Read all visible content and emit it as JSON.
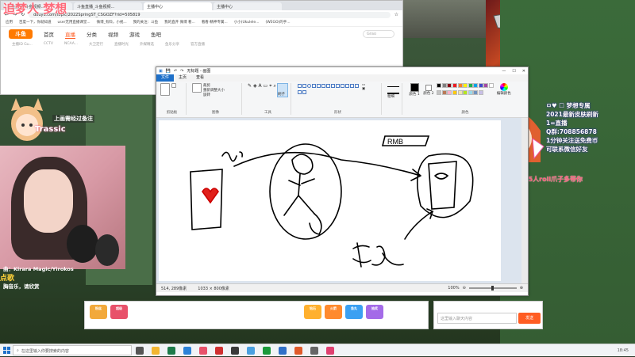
{
  "stream": {
    "title": "追梦人 梦想",
    "chat_notice": "上画需经过备注",
    "chat_user": "Trassic",
    "music_label": "曲：Kirara Magic/Yirokos",
    "music_song": "胸音乐，请欣赏",
    "order_tag": "点歌",
    "rank_text": "钻排近2小时5人roll爪子多带你",
    "right_lines": [
      "ㅁ♥ ☐ 梦想专属",
      "2021最新皮肤刷新",
      "1=直播",
      "Q群:708856878",
      "1分钟关注送免费币",
      "可联系微信好友"
    ]
  },
  "browser": {
    "tabs": [
      "斗鱼直播_斗鱼视频...",
      "斗鱼直播_斗鱼视频...",
      "主播中心",
      "主播中心"
    ],
    "url": "douyu.com/topic/2022SpringST_CSGOZF?rid=505819",
    "bookmarks": [
      "应用",
      "百度一下，你就知道",
      "user无用直播课堂...",
      "微博_有料，小视...",
      "我的关注：斗鱼",
      "我的直开 微博 看...",
      "看看-精神专属...",
      "小小(Ukulele...",
      "(WEGO)的手..."
    ],
    "nav": [
      "首页",
      "直播",
      "分类",
      "视频",
      "游戏",
      "鱼吧"
    ],
    "nav_active": "直播",
    "search_placeholder": "Grao",
    "subnav": [
      "主播ID Gu...",
      "CCTV",
      "NCAA...",
      "大卫定行",
      "直播时光",
      "外媒精选",
      "鱼乐分享",
      "官方直播"
    ]
  },
  "paint": {
    "title": "无标题 - 画图",
    "menu": [
      "文件",
      "主页",
      "查看"
    ],
    "groups": {
      "clipboard": "剪贴板",
      "image": "图像",
      "tools": "工具",
      "shapes": "形状",
      "colors": "颜色"
    },
    "image_actions": [
      "裁剪",
      "重新调整大小",
      "旋转"
    ],
    "tool_labels": [
      "刷子",
      "形状"
    ],
    "size_label": "粗细",
    "color1_label": "颜色 1",
    "color2_label": "颜色 2",
    "edit_colors": "编辑颜色",
    "canvas_text": "RMB",
    "status_pos": "514, 289像素",
    "status_size": "1033 × 800像素",
    "zoom": "100%",
    "palette": [
      "#000000",
      "#7f7f7f",
      "#880015",
      "#ed1c24",
      "#ff7f27",
      "#fff200",
      "#22b14c",
      "#00a2e8",
      "#3f48cc",
      "#a349a4",
      "#ffffff",
      "#c3c3c3",
      "#b97a57",
      "#ffaec9",
      "#ffc90e",
      "#efe4b0",
      "#b5e61d",
      "#99d9ea",
      "#7092be",
      "#c8bfe7"
    ]
  },
  "douyu": {
    "gift_labels": [
      "粉丝",
      "超级",
      "钻石",
      "火箭",
      "鱼丸",
      "抽奖"
    ],
    "danmu_placeholder": "这里输入聊天内容",
    "send": "发送"
  },
  "taskbar": {
    "search_placeholder": "在这里输入你要搜索的内容",
    "tray_text": "18:45"
  }
}
